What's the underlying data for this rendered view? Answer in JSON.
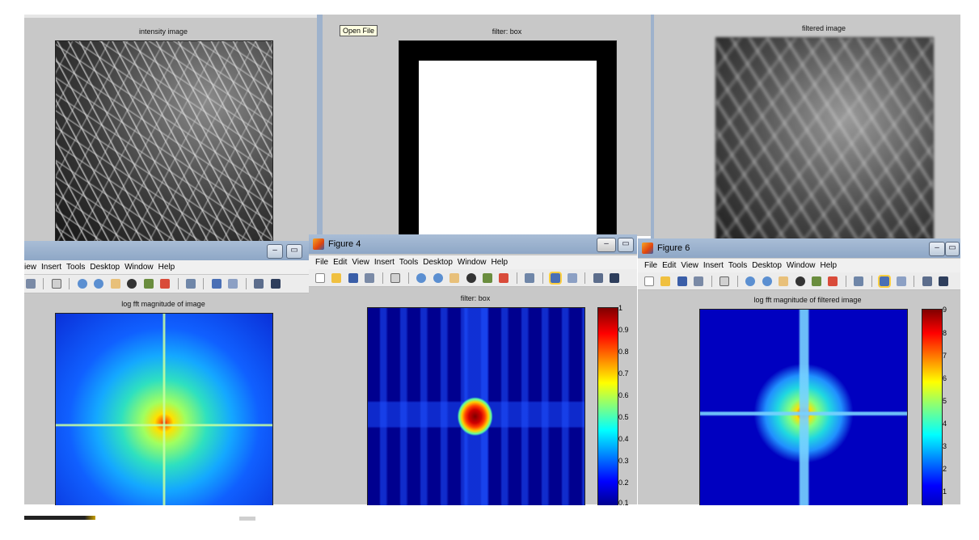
{
  "top_panels": {
    "intensity_title": "intensity image",
    "filter_title": "filter: box",
    "filtered_title": "filtered image",
    "open_file_tooltip": "Open File"
  },
  "figure_left": {
    "menu": [
      "iew",
      "Insert",
      "Tools",
      "Desktop",
      "Window",
      "Help"
    ],
    "plot_title": "log fft magnitude of image"
  },
  "figure_4": {
    "window_title": "Figure 4",
    "menu": [
      "File",
      "Edit",
      "View",
      "Insert",
      "Tools",
      "Desktop",
      "Window",
      "Help"
    ],
    "plot_title": "filter: box",
    "colorbar_ticks": [
      "1",
      "0.9",
      "0.8",
      "0.7",
      "0.6",
      "0.5",
      "0.4",
      "0.3",
      "0.2",
      "0.1"
    ]
  },
  "figure_6": {
    "window_title": "Figure 6",
    "menu": [
      "File",
      "Edit",
      "View",
      "Insert",
      "Tools",
      "Desktop",
      "Window",
      "Help"
    ],
    "plot_title": "log fft magnitude of filtered image",
    "colorbar_ticks": [
      "9",
      "8",
      "7",
      "6",
      "5",
      "4",
      "3",
      "2",
      "1"
    ]
  },
  "colors": {
    "figure_bg": "#c8c8c8",
    "jet_low": "#00008f",
    "jet_high": "#800000"
  }
}
